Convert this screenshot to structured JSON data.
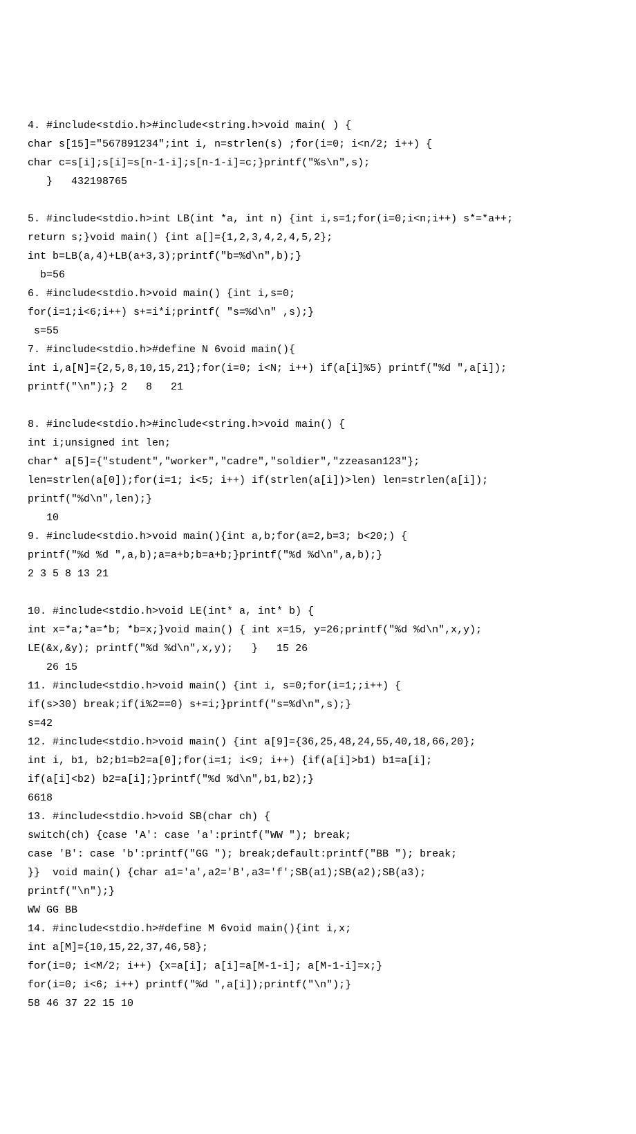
{
  "lines": [
    "4. #include<stdio.h>#include<string.h>void main( ) {",
    "char s[15]=\"567891234\";int i, n=strlen(s) ;for(i=0; i<n/2; i++) {",
    "char c=s[i];s[i]=s[n-1-i];s[n-1-i]=c;}printf(\"%s\\n\",s);",
    "   }   432198765",
    "",
    "5. #include<stdio.h>int LB(int *a, int n) {int i,s=1;for(i=0;i<n;i++) s*=*a++;",
    "return s;}void main() {int a[]={1,2,3,4,2,4,5,2};",
    "int b=LB(a,4)+LB(a+3,3);printf(\"b=%d\\n\",b);}",
    "  b=56",
    "6. #include<stdio.h>void main() {int i,s=0;",
    "for(i=1;i<6;i++) s+=i*i;printf( \"s=%d\\n\" ,s);}",
    " s=55",
    "7. #include<stdio.h>#define N 6void main(){",
    "int i,a[N]={2,5,8,10,15,21};for(i=0; i<N; i++) if(a[i]%5) printf(\"%d \",a[i]);",
    "printf(\"\\n\");} 2   8   21",
    "",
    "8. #include<stdio.h>#include<string.h>void main() {",
    "int i;unsigned int len;",
    "char* a[5]={\"student\",\"worker\",\"cadre\",\"soldier\",\"zzeasan123\"};",
    "len=strlen(a[0]);for(i=1; i<5; i++) if(strlen(a[i])>len) len=strlen(a[i]);",
    "printf(\"%d\\n\",len);}",
    "   10",
    "9. #include<stdio.h>void main(){int a,b;for(a=2,b=3; b<20;) {",
    "printf(\"%d %d \",a,b);a=a+b;b=a+b;}printf(\"%d %d\\n\",a,b);}",
    "2 3 5 8 13 21",
    "",
    "10. #include<stdio.h>void LE(int* a, int* b) {",
    "int x=*a;*a=*b; *b=x;}void main() { int x=15, y=26;printf(\"%d %d\\n\",x,y);",
    "LE(&x,&y); printf(\"%d %d\\n\",x,y);   }   15 26",
    "   26 15",
    "11. #include<stdio.h>void main() {int i, s=0;for(i=1;;i++) {",
    "if(s>30) break;if(i%2==0) s+=i;}printf(\"s=%d\\n\",s);}",
    "s=42",
    "12. #include<stdio.h>void main() {int a[9]={36,25,48,24,55,40,18,66,20};",
    "int i, b1, b2;b1=b2=a[0];for(i=1; i<9; i++) {if(a[i]>b1) b1=a[i];",
    "if(a[i]<b2) b2=a[i];}printf(\"%d %d\\n\",b1,b2);}",
    "6618",
    "13. #include<stdio.h>void SB(char ch) {",
    "switch(ch) {case 'A': case 'a':printf(\"WW \"); break;",
    "case 'B': case 'b':printf(\"GG \"); break;default:printf(\"BB \"); break;",
    "}}  void main() {char a1='a',a2='B',a3='f';SB(a1);SB(a2);SB(a3);",
    "printf(\"\\n\");}",
    "WW GG BB",
    "14. #include<stdio.h>#define M 6void main(){int i,x;",
    "int a[M]={10,15,22,37,46,58};",
    "for(i=0; i<M/2; i++) {x=a[i]; a[i]=a[M-1-i]; a[M-1-i]=x;}",
    "for(i=0; i<6; i++) printf(\"%d \",a[i]);printf(\"\\n\");}",
    "58 46 37 22 15 10"
  ]
}
